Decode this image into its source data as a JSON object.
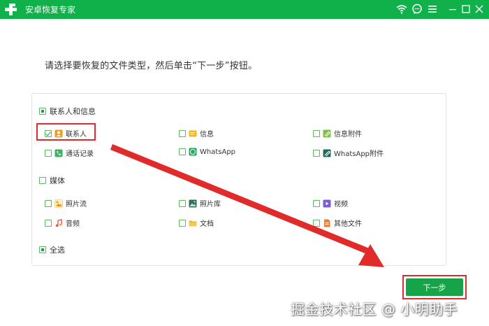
{
  "app": {
    "title": "安卓恢复专家"
  },
  "titlebar_icons": [
    "wifi-icon",
    "chat-icon",
    "menu-icon",
    "minimize-icon",
    "maximize-icon",
    "close-icon"
  ],
  "instruction": "请选择要恢复的文件类型，然后单击“下一步”按钮。",
  "groups": {
    "contacts": {
      "label": "联系人和信息",
      "state": "partial",
      "items": [
        {
          "label": "联系人",
          "checked": true,
          "icon": "contact-icon"
        },
        {
          "label": "信息",
          "checked": false,
          "icon": "message-icon"
        },
        {
          "label": "信息附件",
          "checked": false,
          "icon": "attachment-icon"
        },
        {
          "label": "通话记录",
          "checked": false,
          "icon": "phone-icon"
        },
        {
          "label": "WhatsApp",
          "checked": false,
          "icon": "whatsapp-icon"
        },
        {
          "label": "WhatsApp附件",
          "checked": false,
          "icon": "whatsapp-attachment-icon"
        }
      ]
    },
    "media": {
      "label": "媒体",
      "state": "unchecked",
      "items": [
        {
          "label": "照片流",
          "checked": false,
          "icon": "photo-stream-icon"
        },
        {
          "label": "照片库",
          "checked": false,
          "icon": "photo-library-icon"
        },
        {
          "label": "视频",
          "checked": false,
          "icon": "video-icon"
        },
        {
          "label": "音频",
          "checked": false,
          "icon": "audio-icon"
        },
        {
          "label": "文档",
          "checked": false,
          "icon": "folder-icon"
        },
        {
          "label": "其他文件",
          "checked": false,
          "icon": "file-icon"
        }
      ]
    },
    "select_all": {
      "label": "全选",
      "state": "partial"
    }
  },
  "next_button": {
    "label": "下一步"
  },
  "watermark": "掘金技术社区 @ 小明助手",
  "colors": {
    "brand_green": "#10b04a",
    "button_green": "#16a34a",
    "annotation_red": "#e12b2b"
  }
}
